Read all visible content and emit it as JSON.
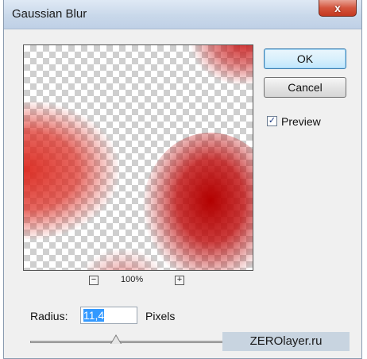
{
  "window": {
    "title": "Gaussian Blur",
    "close_glyph": "x"
  },
  "buttons": {
    "ok_label": "OK",
    "cancel_label": "Cancel"
  },
  "preview_option": {
    "label": "Preview",
    "checked": true,
    "check_glyph": "✓"
  },
  "zoom": {
    "minus_glyph": "−",
    "plus_glyph": "+",
    "level": "100%"
  },
  "radius": {
    "label": "Radius:",
    "value": "11,4",
    "units": "Pixels"
  },
  "slider": {
    "position_fraction": 0.27
  },
  "watermark": "ZEROlayer.ru",
  "icons": [
    "close-icon",
    "zoom-out-icon",
    "zoom-in-icon",
    "checkmark-icon"
  ],
  "colors": {
    "blur_red": "#c81414",
    "ok_border": "#3c7fb1",
    "selection": "#3399ff"
  }
}
